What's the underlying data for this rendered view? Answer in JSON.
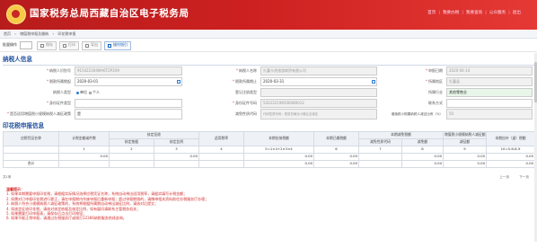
{
  "header": {
    "title": "国家税务总局西藏自治区电子税务局",
    "nav": [
      "首页",
      "我要办税",
      "我要查询",
      "公众服务",
      "退出"
    ]
  },
  "breadcrumb": [
    "首页",
    "›",
    "增值税申报及缴纳",
    "›",
    "印花税申报"
  ],
  "toolbar": {
    "select_label": "批量操作",
    "buttons": [
      "保存",
      "打印",
      "导出",
      "操作指引"
    ]
  },
  "taxpayer": {
    "section_title": "纳税人信息",
    "taxpayer_id_label": "纳税人识别号",
    "taxpayer_id_value": "915422304MA6T2P3X9",
    "taxpayer_name_label": "纳税人名称",
    "taxpayer_name_value": "扎囊卡孜旅游商贸有限公司",
    "apply_date_label": "申报日期",
    "apply_date_value": "2020-04-14",
    "period_start_label": "税款所属期起",
    "period_start_value": "2020-03-01",
    "period_end_label": "税款所属期止",
    "period_end_value": "2020-03-31",
    "region_label": "所属地区",
    "region_value": "扎囊县",
    "taxpayer_type_label": "纳税人类型",
    "type_option_a": "单位",
    "type_option_b": "个人",
    "reg_type_label": "登记注册类型",
    "industry_label": "所属行业",
    "industry_value": "其他零售业",
    "id_type_label": "身份证件类型",
    "id_no_label": "身份证件号码",
    "id_no_value": "542232196506080012",
    "contact_label": "联系方式",
    "small_scale_label": "是否适用增值税小规模纳税人减征政策",
    "small_scale_value": "是",
    "reduction_nature_label": "减免性质代码",
    "reduction_nature_hint": "代码性质代码：税务总局对小微企业减征",
    "small_ratio_label": "增值税小规模纳税人减征比例（%）",
    "small_ratio_value": "50"
  },
  "stamp": {
    "section_title": "印花税申报信息",
    "header_row1": [
      "应税凭证名称",
      "计税金额或件数",
      "核定征收",
      "适用税率",
      "本期应纳税额",
      "本期已缴税额",
      "本期减免税额",
      "增值税小规模纳税人减征额",
      "本期应补（退）税额"
    ],
    "header_row2": [
      "核定依据",
      "核定比例",
      "减免性质代码",
      "减免额",
      "减征额"
    ],
    "number_row": [
      "1",
      "2",
      "3",
      "4",
      "5=1×4+2×3×4",
      "6",
      "7",
      "8",
      "9",
      "10=5-6-8-9"
    ],
    "data_row": [
      "",
      "0.00",
      "0.00",
      "",
      "0.00",
      "0.00",
      "",
      "0.00",
      "0.00",
      "0.00"
    ],
    "total_row": [
      "合计",
      "",
      "",
      "",
      "0.00",
      "0.00",
      "",
      "0.00",
      "0.00",
      "0.00"
    ]
  },
  "pager": {
    "left": "共1条",
    "right": [
      "上一页",
      "下一页"
    ]
  },
  "notes": {
    "title": "温馨提示：",
    "lines": [
      "1. 如果本期需要申报印花税，请根据实际情况选择应税凭证名称，系统自动带出适用税率，请据实填写计税金额；",
      "2. 如需对已申报印花税进行更正，请在申报期内作废申报后重新申报；超过申报期限的，请携带相关资料前往办税服务厅办理；",
      "3. 纳税人符合小规模纳税人减征政策的，系统将根据所属期自动带出减征比例，请核对后提交；",
      "4. 如核定征收印花税，请核对核定依据及核定比例，如有疑问请联系主管税务机关；",
      "5. 如果需要打印申报表，请保存后点击打印按钮；",
      "6. 如果不能正常申报，请通过办税服务厅或拨打12366纳税服务热线咨询。"
    ]
  }
}
